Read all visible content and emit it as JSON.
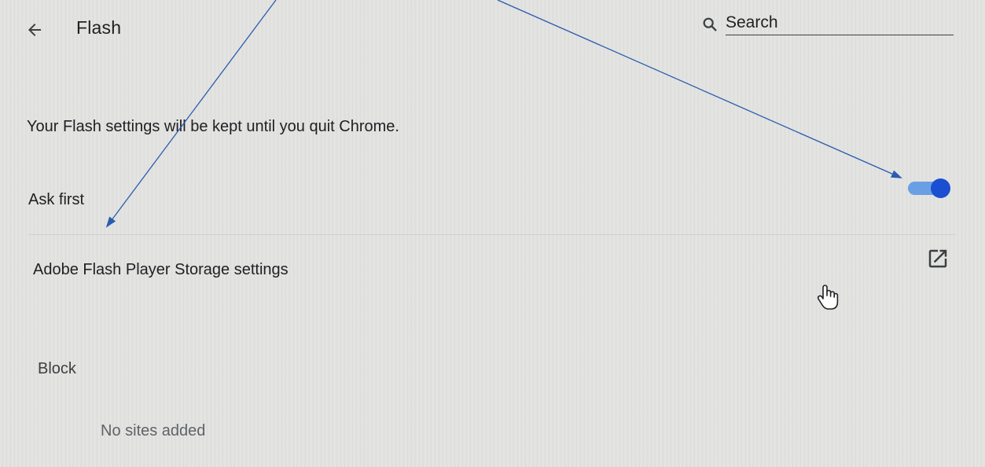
{
  "header": {
    "back_icon": "arrow-left-icon",
    "title": "Flash",
    "search": {
      "icon": "search-icon",
      "placeholder": "Search",
      "value": ""
    }
  },
  "info": {
    "text": "Your Flash settings will be kept until you quit Chrome."
  },
  "ask_first": {
    "label": "Ask first",
    "toggle_on": true,
    "toggle_color": "#1b4fd2"
  },
  "storage": {
    "label": "Adobe Flash Player Storage settings",
    "icon": "external-link-icon"
  },
  "block": {
    "label": "Block",
    "empty_text": "No sites added"
  },
  "colors": {
    "background": "#e3e3e1",
    "annotation_arrow": "#2a5db0"
  }
}
